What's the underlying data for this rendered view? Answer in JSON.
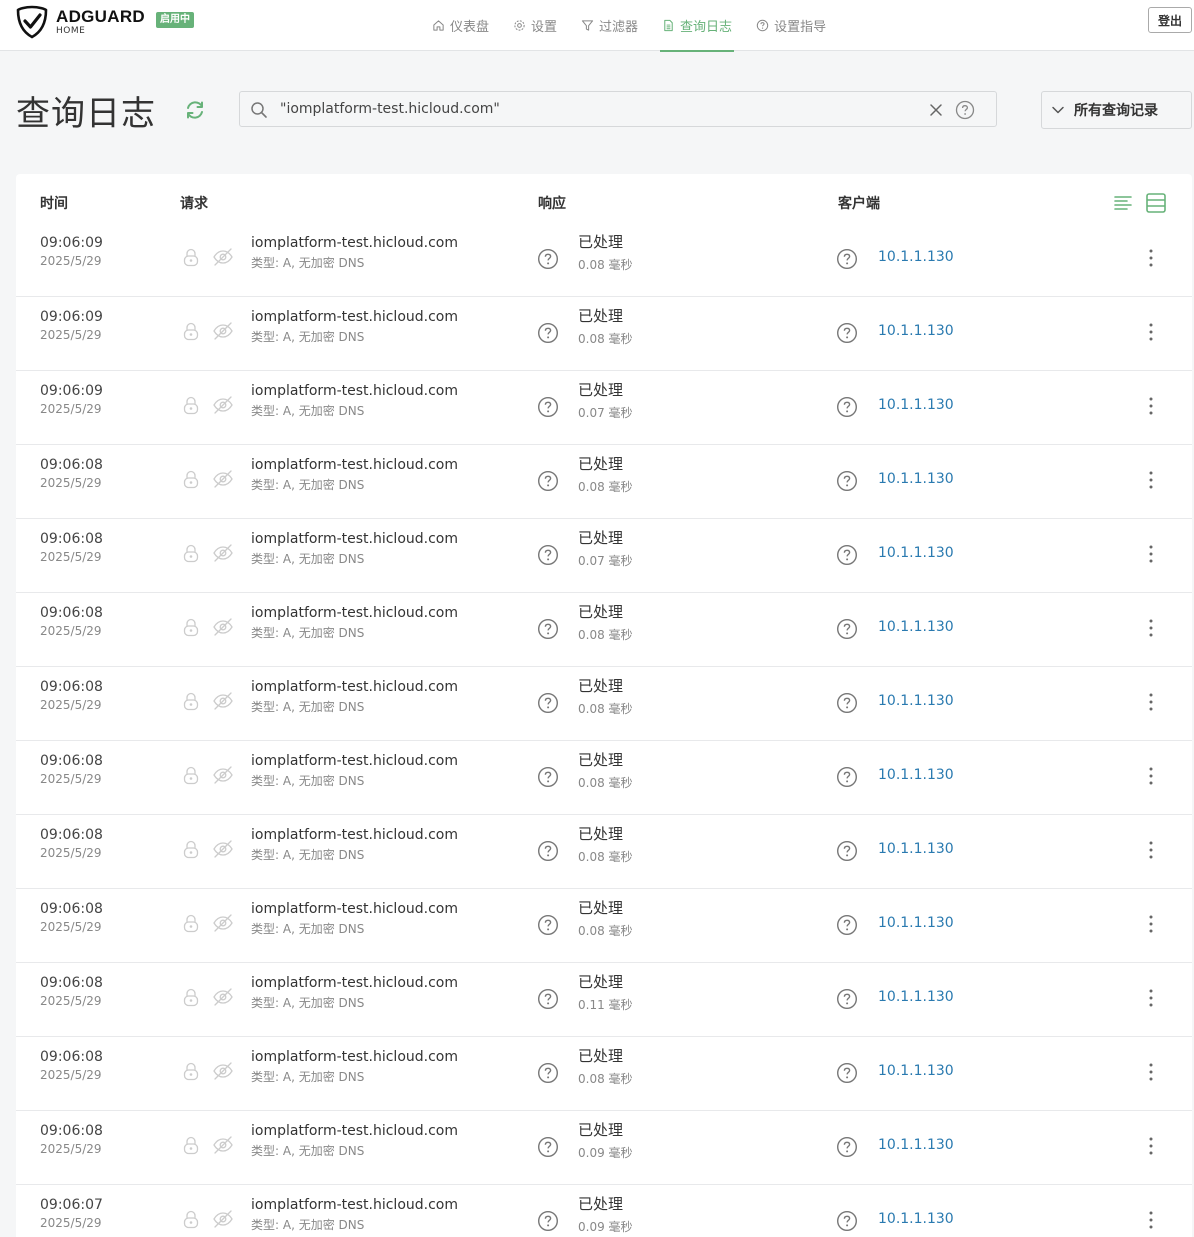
{
  "app": {
    "logo_title": "ADGUARD",
    "logo_sub": "HOME",
    "status_badge": "启用中",
    "logout_label": "登出",
    "accent_color": "#67b279"
  },
  "nav": {
    "items": [
      {
        "label": "仪表盘",
        "icon": "home-icon",
        "active": false
      },
      {
        "label": "设置",
        "icon": "gear-icon",
        "active": false
      },
      {
        "label": "过滤器",
        "icon": "filter-icon",
        "active": false
      },
      {
        "label": "查询日志",
        "icon": "document-icon",
        "active": true
      },
      {
        "label": "设置指导",
        "icon": "help-circle-icon",
        "active": false
      }
    ]
  },
  "page": {
    "title": "查询日志"
  },
  "search": {
    "value": "\"iomplatform-test.hicloud.com\""
  },
  "filter": {
    "selected": "所有查询记录"
  },
  "table": {
    "headers": {
      "time": "时间",
      "request": "请求",
      "response": "响应",
      "client": "客户端"
    },
    "rows": [
      {
        "time": "09:06:09",
        "date": "2025/5/29",
        "domain": "iomplatform-test.hicloud.com",
        "type": "类型: A, 无加密 DNS",
        "status": "已处理",
        "elapsed": "0.08 毫秒",
        "client": "10.1.1.130"
      },
      {
        "time": "09:06:09",
        "date": "2025/5/29",
        "domain": "iomplatform-test.hicloud.com",
        "type": "类型: A, 无加密 DNS",
        "status": "已处理",
        "elapsed": "0.08 毫秒",
        "client": "10.1.1.130"
      },
      {
        "time": "09:06:09",
        "date": "2025/5/29",
        "domain": "iomplatform-test.hicloud.com",
        "type": "类型: A, 无加密 DNS",
        "status": "已处理",
        "elapsed": "0.07 毫秒",
        "client": "10.1.1.130"
      },
      {
        "time": "09:06:08",
        "date": "2025/5/29",
        "domain": "iomplatform-test.hicloud.com",
        "type": "类型: A, 无加密 DNS",
        "status": "已处理",
        "elapsed": "0.08 毫秒",
        "client": "10.1.1.130"
      },
      {
        "time": "09:06:08",
        "date": "2025/5/29",
        "domain": "iomplatform-test.hicloud.com",
        "type": "类型: A, 无加密 DNS",
        "status": "已处理",
        "elapsed": "0.07 毫秒",
        "client": "10.1.1.130"
      },
      {
        "time": "09:06:08",
        "date": "2025/5/29",
        "domain": "iomplatform-test.hicloud.com",
        "type": "类型: A, 无加密 DNS",
        "status": "已处理",
        "elapsed": "0.08 毫秒",
        "client": "10.1.1.130"
      },
      {
        "time": "09:06:08",
        "date": "2025/5/29",
        "domain": "iomplatform-test.hicloud.com",
        "type": "类型: A, 无加密 DNS",
        "status": "已处理",
        "elapsed": "0.08 毫秒",
        "client": "10.1.1.130"
      },
      {
        "time": "09:06:08",
        "date": "2025/5/29",
        "domain": "iomplatform-test.hicloud.com",
        "type": "类型: A, 无加密 DNS",
        "status": "已处理",
        "elapsed": "0.08 毫秒",
        "client": "10.1.1.130"
      },
      {
        "time": "09:06:08",
        "date": "2025/5/29",
        "domain": "iomplatform-test.hicloud.com",
        "type": "类型: A, 无加密 DNS",
        "status": "已处理",
        "elapsed": "0.08 毫秒",
        "client": "10.1.1.130"
      },
      {
        "time": "09:06:08",
        "date": "2025/5/29",
        "domain": "iomplatform-test.hicloud.com",
        "type": "类型: A, 无加密 DNS",
        "status": "已处理",
        "elapsed": "0.08 毫秒",
        "client": "10.1.1.130"
      },
      {
        "time": "09:06:08",
        "date": "2025/5/29",
        "domain": "iomplatform-test.hicloud.com",
        "type": "类型: A, 无加密 DNS",
        "status": "已处理",
        "elapsed": "0.11 毫秒",
        "client": "10.1.1.130"
      },
      {
        "time": "09:06:08",
        "date": "2025/5/29",
        "domain": "iomplatform-test.hicloud.com",
        "type": "类型: A, 无加密 DNS",
        "status": "已处理",
        "elapsed": "0.08 毫秒",
        "client": "10.1.1.130"
      },
      {
        "time": "09:06:08",
        "date": "2025/5/29",
        "domain": "iomplatform-test.hicloud.com",
        "type": "类型: A, 无加密 DNS",
        "status": "已处理",
        "elapsed": "0.09 毫秒",
        "client": "10.1.1.130"
      },
      {
        "time": "09:06:07",
        "date": "2025/5/29",
        "domain": "iomplatform-test.hicloud.com",
        "type": "类型: A, 无加密 DNS",
        "status": "已处理",
        "elapsed": "0.09 毫秒",
        "client": "10.1.1.130"
      }
    ]
  }
}
